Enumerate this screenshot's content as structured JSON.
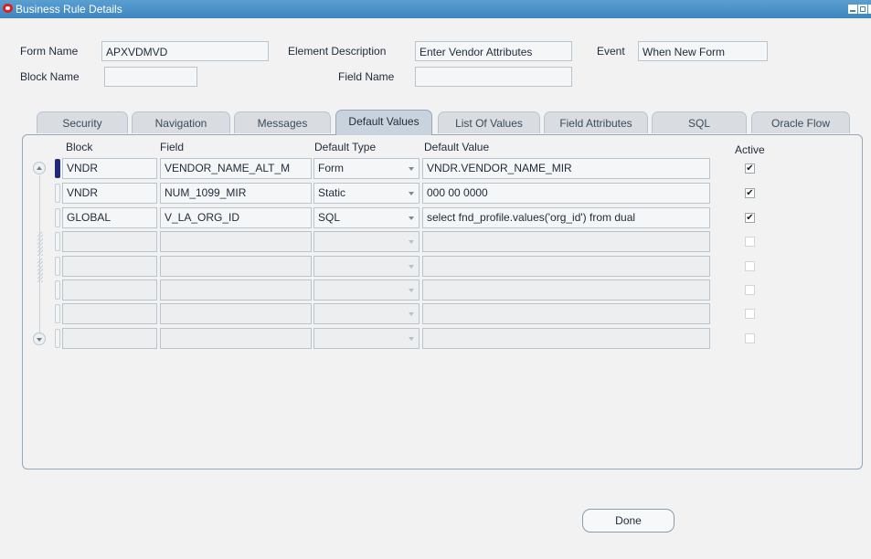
{
  "window": {
    "title": "Business Rule Details"
  },
  "header": {
    "form_name_label": "Form Name",
    "form_name_value": "APXVDMVD",
    "element_description_label": "Element Description",
    "element_description_value": "Enter Vendor Attributes",
    "event_label": "Event",
    "event_value": "When New Form",
    "block_name_label": "Block Name",
    "block_name_value": "",
    "field_name_label": "Field Name",
    "field_name_value": ""
  },
  "tabs": [
    {
      "label": "Security",
      "active": false
    },
    {
      "label": "Navigation",
      "active": false
    },
    {
      "label": "Messages",
      "active": false
    },
    {
      "label": "Default Values",
      "active": true
    },
    {
      "label": "List Of Values",
      "active": false
    },
    {
      "label": "Field Attributes",
      "active": false
    },
    {
      "label": "SQL",
      "active": false
    },
    {
      "label": "Oracle Flow",
      "active": false
    }
  ],
  "table": {
    "columns": [
      "Block",
      "Field",
      "Default Type",
      "Default Value",
      "Active"
    ],
    "rows": [
      {
        "block": "VNDR",
        "field": "VENDOR_NAME_ALT_M",
        "type": "Form",
        "value": "VNDR.VENDOR_NAME_MIR",
        "active": true
      },
      {
        "block": "VNDR",
        "field": "NUM_1099_MIR",
        "type": "Static",
        "value": "000 00 0000",
        "active": true
      },
      {
        "block": "GLOBAL",
        "field": "V_LA_ORG_ID",
        "type": "SQL",
        "value": "select fnd_profile.values('org_id') from dual",
        "active": true
      },
      {
        "block": "",
        "field": "",
        "type": "",
        "value": "",
        "active": false
      },
      {
        "block": "",
        "field": "",
        "type": "",
        "value": "",
        "active": false
      },
      {
        "block": "",
        "field": "",
        "type": "",
        "value": "",
        "active": false
      },
      {
        "block": "",
        "field": "",
        "type": "",
        "value": "",
        "active": false
      },
      {
        "block": "",
        "field": "",
        "type": "",
        "value": "",
        "active": false
      }
    ]
  },
  "buttons": {
    "done": "Done"
  },
  "check_mark": "✔"
}
